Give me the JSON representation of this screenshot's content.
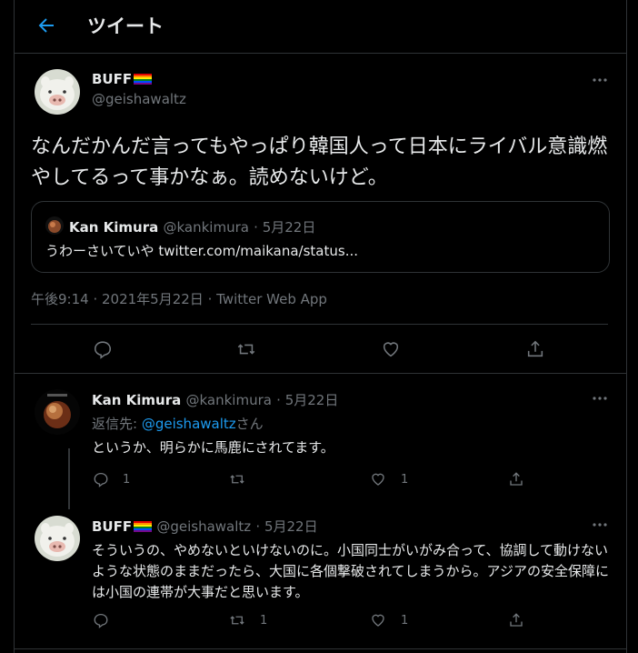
{
  "header": {
    "title": "ツイート"
  },
  "main_tweet": {
    "name": "BUFF",
    "handle": "@geishawaltz",
    "text": "なんだかんだ言ってもやっぱり韓国人って日本にライバル意識燃やしてるって事かなぁ。読めないけど。",
    "quote": {
      "name": "Kan Kimura",
      "handle": "@kankimura",
      "date": "· 5月22日",
      "text": "うわーさいていや twitter.com/maikana/status..."
    },
    "time": "午後9:14",
    "date": "2021年5月22日",
    "source": "Twitter Web App",
    "sep": " · "
  },
  "replies": [
    {
      "name": "Kan Kimura",
      "handle": "@kankimura",
      "date": "· 5月22日",
      "reply_to_prefix": "返信先: ",
      "reply_to_handle": "@geishawaltz",
      "reply_to_suffix": "さん",
      "text": "というか、明らかに馬鹿にされてます。",
      "reply_count": "1",
      "retweet_count": "",
      "like_count": "1"
    },
    {
      "name": "BUFF",
      "handle": "@geishawaltz",
      "date": "· 5月22日",
      "text": "そういうの、やめないといけないのに。小国同士がいがみ合って、協調して動けないような状態のままだったら、大国に各個撃破されてしまうから。アジアの安全保障には小国の連帯が大事だと思います。",
      "reply_count": "",
      "retweet_count": "1",
      "like_count": "1"
    }
  ],
  "colors": {
    "accent": "#1d9bf0",
    "border": "#2f3336",
    "muted": "#71767b",
    "text": "#e7e9ea"
  },
  "icons": [
    "back-arrow-icon",
    "more-icon",
    "reply-icon",
    "retweet-icon",
    "like-icon",
    "share-icon"
  ]
}
